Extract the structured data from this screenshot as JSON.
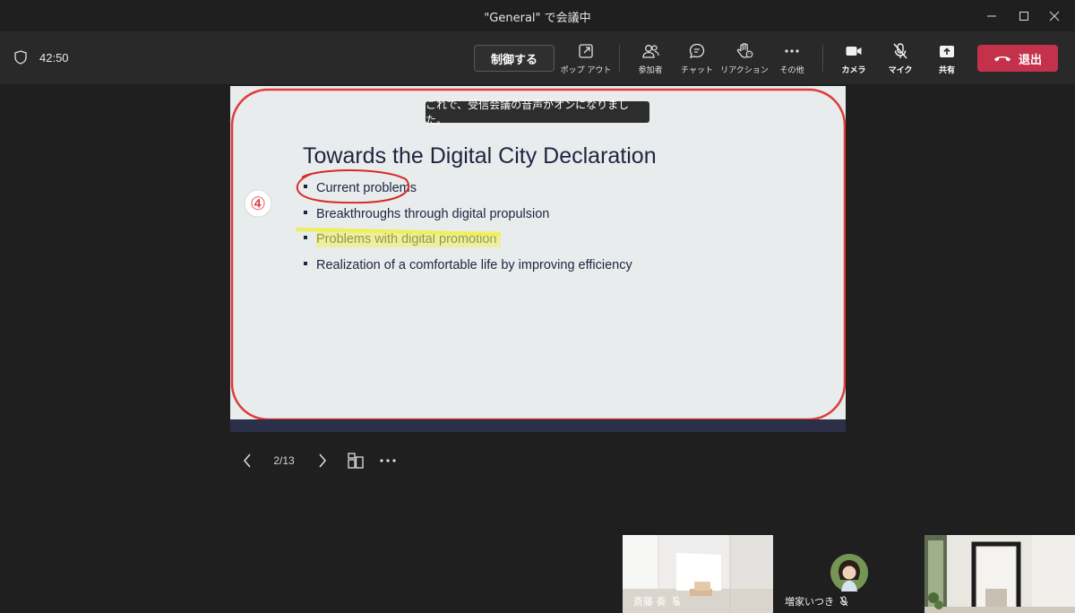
{
  "window": {
    "title": "\"General\" で会議中"
  },
  "toolbar": {
    "timer": "42:50",
    "control_label": "制御する",
    "popout_label": "ポップ アウト",
    "participants_label": "参加者",
    "chat_label": "チャット",
    "reaction_label": "リアクション",
    "more_label": "その他",
    "camera_label": "カメラ",
    "mic_label": "マイク",
    "share_label": "共有",
    "leave_label": "退出",
    "leave_color": "#c4314b"
  },
  "stage": {
    "caption": "これで、受信会議の音声がオンになりました。",
    "slide": {
      "title": "Towards the Digital City Declaration",
      "bullets": [
        "Current problems",
        "Breakthroughs through digital propulsion",
        "Problems with digital promotion",
        "Realization of a comfortable life by improving efficiency"
      ],
      "annotation_number": "④"
    },
    "nav": {
      "counter": "2/13"
    }
  },
  "participants": [
    {
      "name": "斎藤 奏"
    },
    {
      "name": "増家いつき"
    },
    {
      "name": ""
    }
  ]
}
